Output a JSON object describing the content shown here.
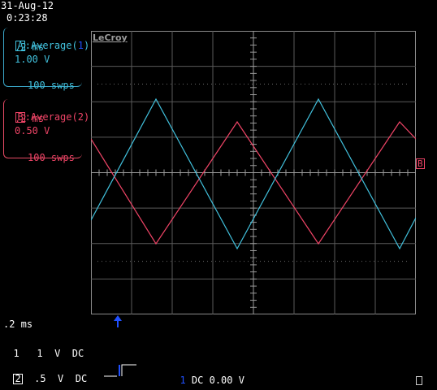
{
  "header": {
    "date": "31-Aug-12",
    "time": "0:23:28"
  },
  "traceA": {
    "id": "A",
    "mode": "Average",
    "src": "1",
    "timebase": ".2 ms",
    "vdiv": "1.00 V",
    "sweeps": "100 swps",
    "color": "#41c0dc"
  },
  "traceB": {
    "id": "B",
    "mode": "Average",
    "src": "2",
    "timebase": ".2 ms",
    "vdiv": "0.50 V",
    "sweeps": "100 swps",
    "color": "#ee4466"
  },
  "brand": "LeCroy",
  "marker_right": "B",
  "bottom": {
    "timebase": ".2 ms",
    "ch1": {
      "num": "1",
      "volts": "1",
      "unit": "V",
      "coupling": "DC"
    },
    "ch2": {
      "num": "2",
      "volts": ".5",
      "unit": "V",
      "coupling": "DC"
    },
    "trigger": {
      "num": "1",
      "text": "DC 0.00 V"
    }
  },
  "colors": {
    "grid": "#7a7a7a",
    "trigger_blue": "#2050ff"
  }
}
